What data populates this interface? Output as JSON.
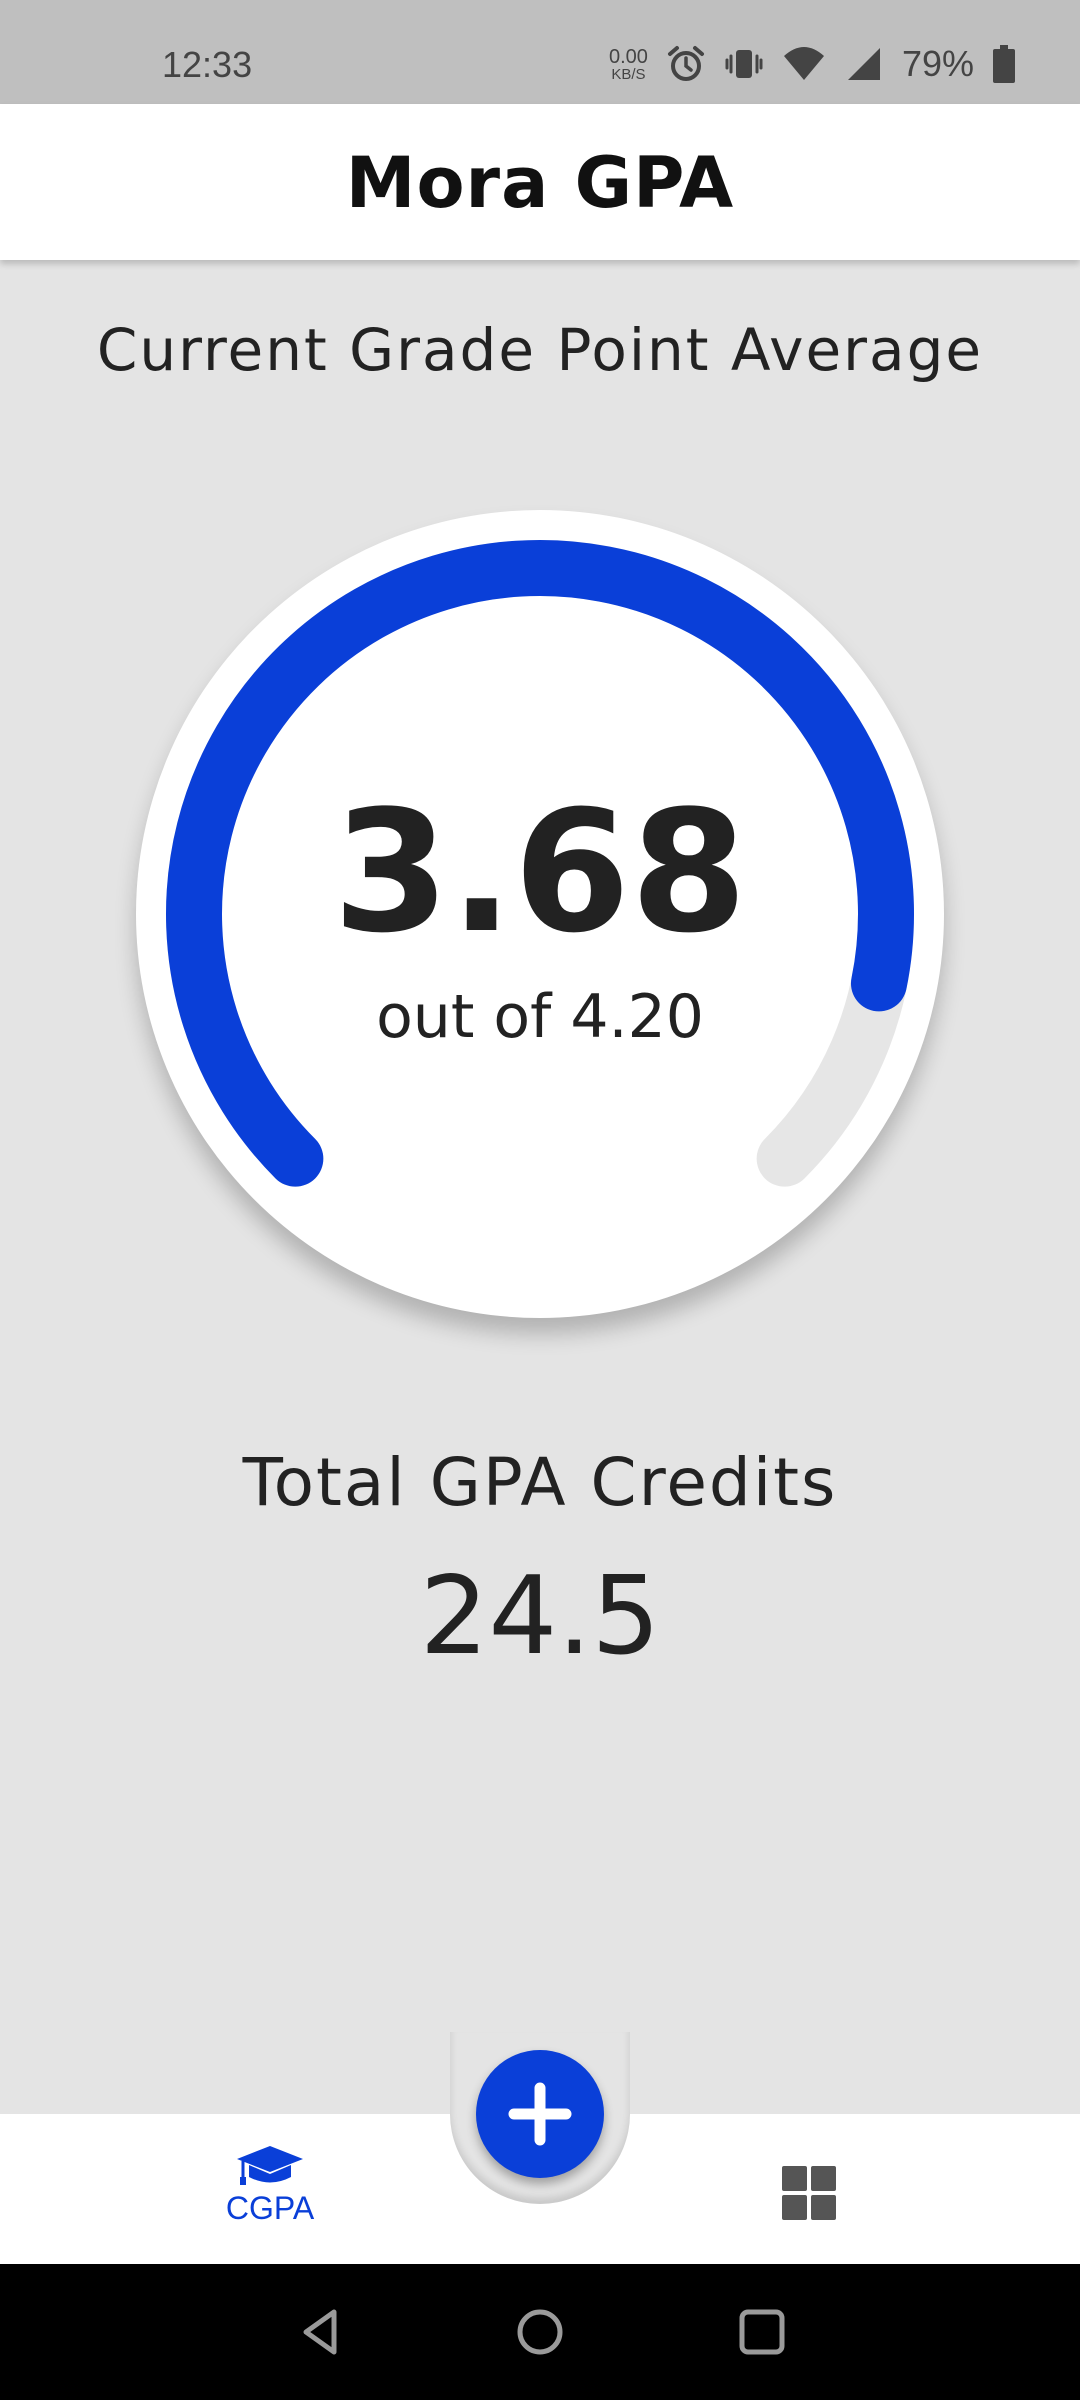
{
  "status_bar": {
    "time": "12:33",
    "net_speed_value": "0.00",
    "net_speed_unit": "KB/S",
    "battery_percent": "79%",
    "icons": [
      "alarm-icon",
      "vibrate-icon",
      "wifi-icon",
      "cellular-signal-icon",
      "battery-icon"
    ]
  },
  "app_bar": {
    "title": "Mora GPA"
  },
  "gpa": {
    "heading": "Current Grade Point Average",
    "value": "3.68",
    "out_of": "out of 4.20",
    "current": 3.68,
    "max": 4.2,
    "accent_color": "#0a3fd8",
    "track_color": "#e6e6e6"
  },
  "credits": {
    "label": "Total GPA Credits",
    "value": "24.5"
  },
  "bottom_nav": {
    "cgpa_label": "CGPA",
    "fab_icon": "plus-icon",
    "cgpa_icon": "graduation-cap-icon",
    "dashboard_icon": "dashboard-grid-icon",
    "active_color": "#0a3fd8",
    "inactive_color": "#555555"
  },
  "system_nav": {
    "icons": [
      "back-icon",
      "home-icon",
      "recents-icon"
    ]
  }
}
